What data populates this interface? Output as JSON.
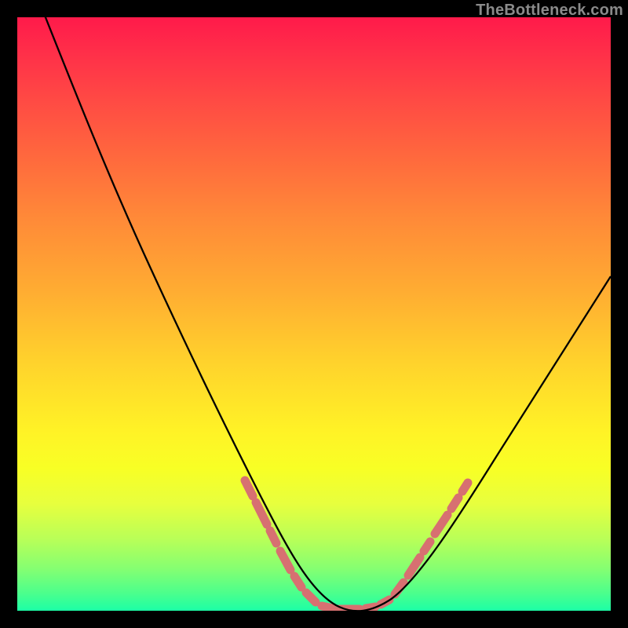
{
  "watermark": "TheBottleneck.com",
  "colors": {
    "background": "#000000",
    "gradient_top": "#ff1a4a",
    "gradient_bottom": "#1cffa6",
    "curve": "#000000",
    "dash": "#d77071"
  },
  "chart_data": {
    "type": "line",
    "title": "",
    "xlabel": "",
    "ylabel": "",
    "xlim": [
      0,
      100
    ],
    "ylim": [
      0,
      100
    ],
    "x": [
      0,
      5,
      10,
      15,
      20,
      25,
      30,
      35,
      40,
      45,
      50,
      53,
      56,
      58,
      60,
      65,
      70,
      75,
      80,
      85,
      90,
      95,
      100
    ],
    "values": [
      109,
      98,
      87,
      76,
      65,
      54,
      43,
      32,
      22,
      13,
      6,
      2,
      0.5,
      0,
      0.5,
      4,
      10,
      18,
      26,
      34,
      42,
      50,
      58
    ],
    "annotations": [
      {
        "note": "dashed-highlight-left",
        "x_range": [
          38,
          52
        ]
      },
      {
        "note": "dashed-highlight-flat",
        "x_range": [
          52,
          62
        ]
      },
      {
        "note": "dashed-highlight-right",
        "x_range": [
          62,
          72
        ]
      }
    ]
  }
}
